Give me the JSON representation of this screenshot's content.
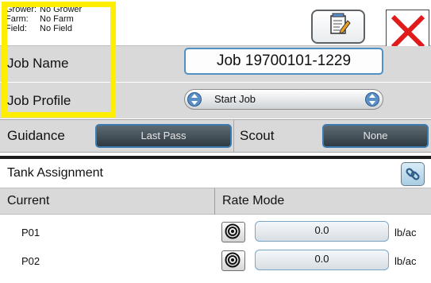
{
  "header": {
    "grower_key": "Grower:",
    "grower_value": "No Grower",
    "farm_key": "Farm:",
    "farm_value": "No Farm",
    "field_key": "Field:",
    "field_value": "No Field",
    "edit_icon": "notepad-edit-icon",
    "close_icon": "red-x-close-icon"
  },
  "job": {
    "name_label": "Job Name",
    "name_value": "Job 19700101-1229",
    "profile_label": "Job Profile",
    "profile_value": "Start Job"
  },
  "guidance": {
    "label": "Guidance",
    "button": "Last Pass"
  },
  "scout": {
    "label": "Scout",
    "button": "None"
  },
  "tank": {
    "label": "Tank Assignment",
    "link_icon": "link-chain-icon"
  },
  "columns": {
    "current": "Current",
    "rate_mode": "Rate Mode"
  },
  "products": [
    {
      "name": "P01",
      "rate": "0.0",
      "unit": "lb/ac"
    },
    {
      "name": "P02",
      "rate": "0.0",
      "unit": "lb/ac"
    }
  ],
  "colors": {
    "highlight": "#ffee00",
    "accent_blue": "#3b7bb0",
    "row_gray": "#d9d9d9"
  }
}
